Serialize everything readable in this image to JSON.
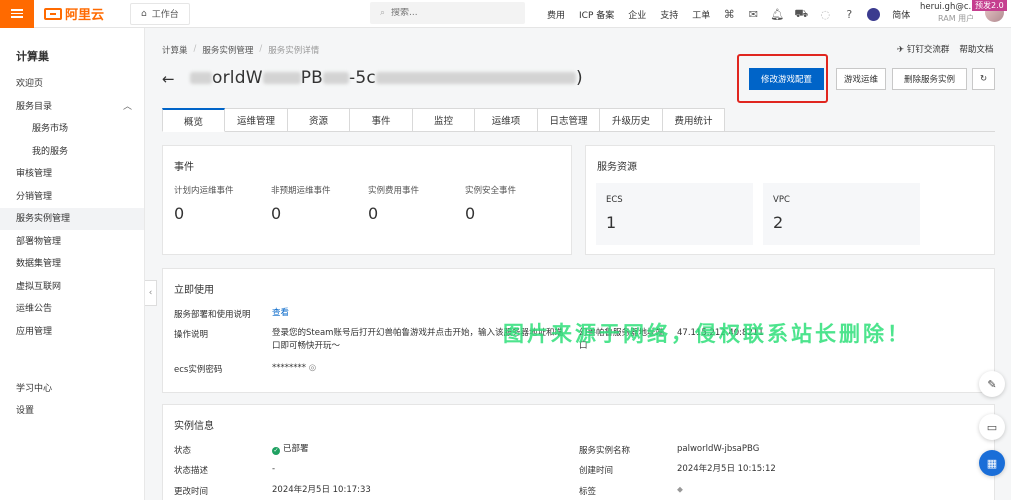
{
  "topbar": {
    "logo_text": "阿里云",
    "workbench": "工作台",
    "search_placeholder": "搜索...",
    "nav": [
      "费用",
      "ICP 备案",
      "企业",
      "支持",
      "工单"
    ],
    "language": "简体",
    "user_name": "herui.gh@c...",
    "user_role": "RAM 用户",
    "prerelease": "预发2.0"
  },
  "sidebar": {
    "title": "计算巢",
    "items": [
      {
        "label": "欢迎页"
      },
      {
        "label": "服务目录"
      },
      {
        "label": "服务市场"
      },
      {
        "label": "我的服务"
      },
      {
        "label": "审核管理"
      },
      {
        "label": "分销管理"
      },
      {
        "label": "服务实例管理"
      },
      {
        "label": "部署物管理"
      },
      {
        "label": "数据集管理"
      },
      {
        "label": "虚拟互联网"
      },
      {
        "label": "运维公告"
      },
      {
        "label": "应用管理"
      },
      {
        "label": "学习中心"
      },
      {
        "label": "设置"
      }
    ]
  },
  "breadcrumb": [
    "计算巢",
    "服务实例管理",
    "服务实例详情"
  ],
  "page": {
    "title_visible_1": "orldW",
    "title_visible_2": "PB",
    "title_visible_3": "-5c",
    "title_visible_4": ")"
  },
  "header_links": {
    "dingtalk": "钉钉交流群",
    "help": "帮助文档"
  },
  "actions": {
    "modify_game_config": "修改游戏配置",
    "game_ops": "游戏运维",
    "delete_instance": "删除服务实例"
  },
  "tabs": [
    "概览",
    "运维管理",
    "资源",
    "事件",
    "监控",
    "运维项",
    "日志管理",
    "升级历史",
    "费用统计"
  ],
  "events": {
    "title": "事件",
    "metrics": [
      {
        "label": "计划内运维事件",
        "value": "0"
      },
      {
        "label": "非预期运维事件",
        "value": "0"
      },
      {
        "label": "实例费用事件",
        "value": "0"
      },
      {
        "label": "实例安全事件",
        "value": "0"
      }
    ]
  },
  "resources": {
    "title": "服务资源",
    "items": [
      {
        "label": "ECS",
        "value": "1"
      },
      {
        "label": "VPC",
        "value": "2"
      }
    ]
  },
  "usage": {
    "title": "立即使用",
    "doc_label": "服务部署和使用说明",
    "doc_link": "查看",
    "op_label": "操作说明",
    "op_text_line1": "登录您的Steam账号后打开幻兽帕鲁游戏并点击开始，输入该服务器地址和端",
    "op_text_line2": "口即可畅快开玩～",
    "server_label_line1": "幻兽帕鲁服务器地址端",
    "server_label_line2": "口",
    "server_value": "47.115.212.40:8211",
    "pwd_label": "ecs实例密码",
    "pwd_value": "********"
  },
  "watermark": "图片来源于网络，侵权联系站长删除！",
  "instance": {
    "title": "实例信息",
    "status_label": "状态",
    "status_value": "已部署",
    "desc_label": "状态描述",
    "desc_value": "-",
    "update_label": "更改时间",
    "update_value": "2024年2月5日 10:17:33",
    "name_label": "服务实例名称",
    "name_value": "palworldW-jbsaPBG",
    "created_label": "创建时间",
    "created_value": "2024年2月5日 10:15:12",
    "tag_label": "标签"
  }
}
